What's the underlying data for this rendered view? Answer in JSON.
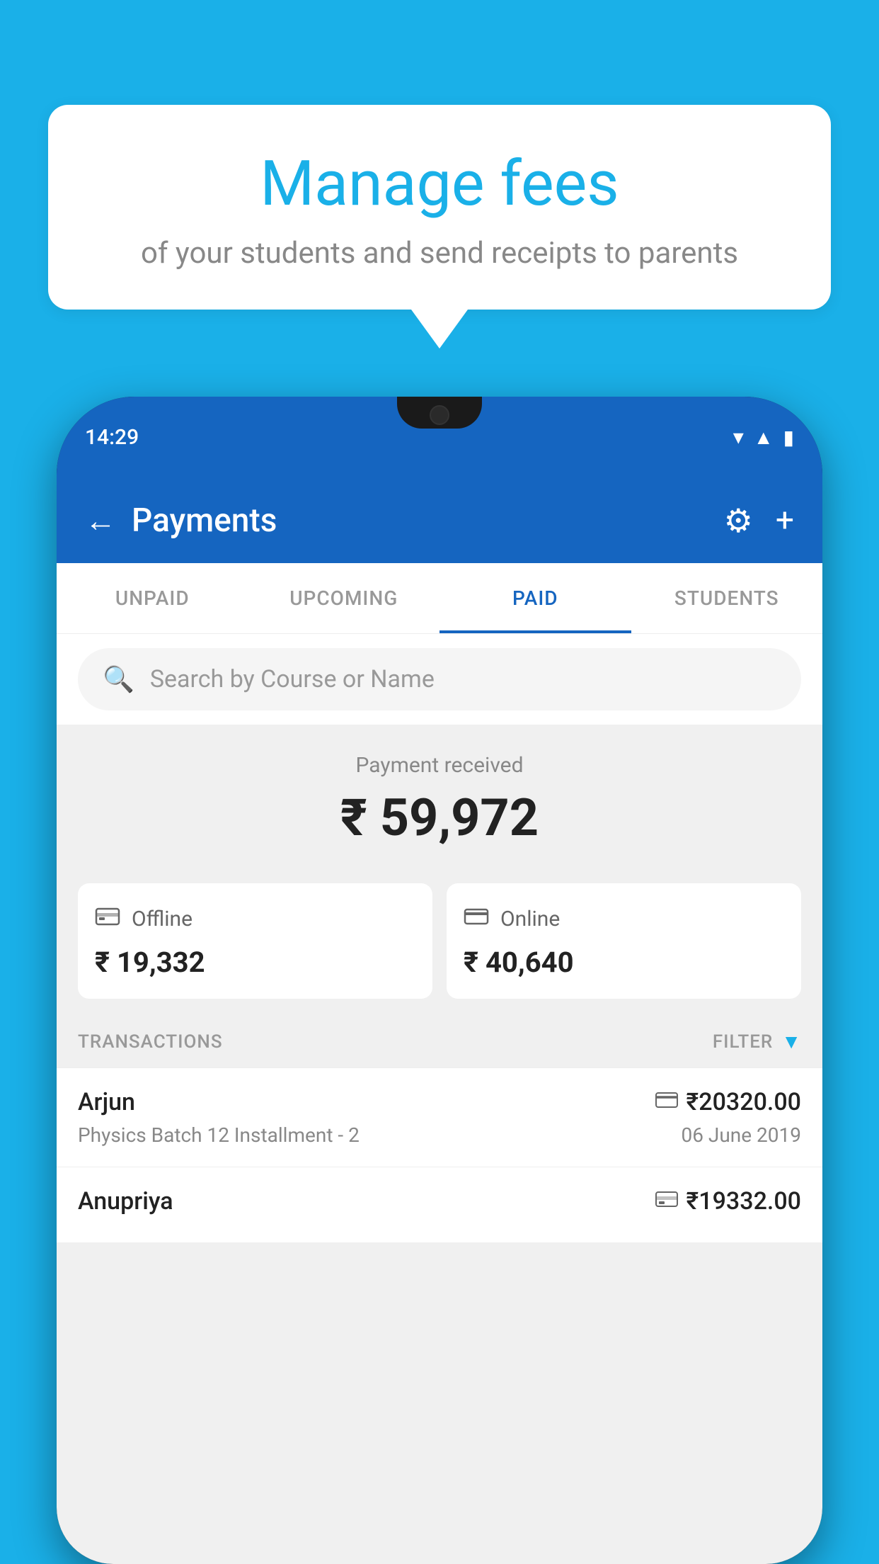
{
  "background_color": "#1ab0e8",
  "bubble": {
    "heading": "Manage fees",
    "subtext": "of your students and send receipts to parents"
  },
  "status_bar": {
    "time": "14:29",
    "wifi": "▾",
    "signal": "▲",
    "battery": "▮"
  },
  "header": {
    "title": "Payments",
    "back_icon": "←",
    "gear_icon": "⚙",
    "plus_icon": "+"
  },
  "tabs": [
    {
      "label": "UNPAID",
      "active": false
    },
    {
      "label": "UPCOMING",
      "active": false
    },
    {
      "label": "PAID",
      "active": true
    },
    {
      "label": "STUDENTS",
      "active": false
    }
  ],
  "search": {
    "placeholder": "Search by Course or Name"
  },
  "payment_received": {
    "label": "Payment received",
    "amount": "₹ 59,972"
  },
  "payment_cards": [
    {
      "type": "Offline",
      "amount": "₹ 19,332",
      "icon": "offline"
    },
    {
      "type": "Online",
      "amount": "₹ 40,640",
      "icon": "online"
    }
  ],
  "transactions": {
    "section_label": "TRANSACTIONS",
    "filter_label": "FILTER",
    "items": [
      {
        "name": "Arjun",
        "course": "Physics Batch 12 Installment - 2",
        "amount": "₹20320.00",
        "date": "06 June 2019",
        "payment_type": "online"
      },
      {
        "name": "Anupriya",
        "course": "",
        "amount": "₹19332.00",
        "date": "",
        "payment_type": "offline"
      }
    ]
  }
}
